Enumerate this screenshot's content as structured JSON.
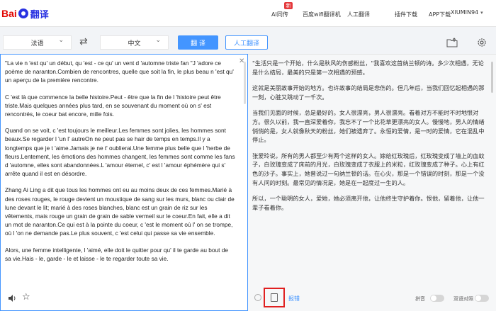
{
  "header": {
    "logo_text": "Bai",
    "logo_text_2": "du",
    "logo_suffix": "翻译",
    "nav": [
      {
        "label": "AI同传",
        "badge": "新"
      },
      {
        "label": "百度wifi翻译机"
      },
      {
        "label": "人工翻译"
      },
      {
        "label": "插件下载"
      },
      {
        "label": "APP下载"
      }
    ],
    "user": "XIUMIN94"
  },
  "toolbar": {
    "source_lang": "法语",
    "target_lang": "中文",
    "translate_label": "翻 译",
    "human_label": "人工翻译",
    "icons": [
      "swap-icon",
      "folder-upload-icon",
      "settings-icon"
    ]
  },
  "source": {
    "paragraphs": [
      "\"La vie n 'est qu' un début, qu 'est - ce qu' un vent d 'automne triste fan \"J 'adore ce poème de naranton.Combien de rencontres, quelle que soit la fin, le plus beau n 'est qu' un aperçu de la première rencontre.",
      "C 'est là que commence la belle histoire.Peut - être que la fin de l 'histoire peut être triste.Mais quelques années plus tard, en se souvenant du moment où on s' est rencontrés, le coeur bat encore, mille fois.",
      "Quand on se voit, c 'est toujours le meilleur.Les femmes sont jolies, les hommes sont beaux.Se regarder l 'un l' autreOn ne peut pas se hair de temps en temps.Il y a longtemps que je t 'aime.Jamais je ne t' oublierai.Une femme plus belle que l 'herbe de fleurs.Lentement, les émotions des hommes changent, les femmes sont comme les fans d 'automne, elles sont abandonnées.L 'amour éternel, c' est l 'amour éphémère qui s' arrête quand il est en désordre.",
      "Zhang Ai Ling a dit que tous les hommes ont eu au moins deux de ces femmes.Marié à des roses rouges, le rouge devient un moustique de sang sur les murs, blanc ou clair de lune devant le lit; marié à des roses blanches, blanc est un grain de riz sur les vêtements, mais rouge un grain de grain de sable vermeil sur le coeur.En fait, elle a dit un mot de naranton.Ce qui est à la pointe du coeur, c 'est le moment où l' on se trompe, où l 'on ne demande pas.Le plus souvent, c 'est celui qui passe sa vie ensemble.",
      "Alors, une femme intelligente, l 'aimé, elle doit le quitter pour qu' il te garde au bout de sa vie.Hais - le, garde - le et laisse - le te regarder toute sa vie."
    ]
  },
  "target": {
    "paragraphs": [
      "\"生活只是一个开始，什么是秋风的伤感粉丝，\"我喜欢这首纳兰顿的诗。多少次相遇，无论是什么结局，最美的只是第一次相遇的预感。",
      "这就是美丽故事开始的地方。也许故事的结局是悲伤的。但几年后，当我们回忆起相遇的那一刻，心脏又跳动了一千次。",
      "当我们见面的时候，总是最好的。女人很漂亮，男人很漂亮。看着对方不能时不时地恨对方。很久以前，我一直深爱着你，我忘不了一个比花草更漂亮的女人。慢慢地，男人的情绪悄悄的是，女人就像秋天的粉丝，她们被遗弃了。永恒的爱情，是一时的爱情，它在混乱中停止。",
      "张爱玲说，所有的男人都至少有两个这样的女人。嫁给红玫瑰后，红玫瑰变成了墙上的血蚊子，白玫瑰变成了床前的月光，白玫瑰变成了衣服上的米粒，红玫瑰变成了种子。心上有红色的沙子。事实上，她曾说过一句纳兰顿的话。在心尖，那是一个错误的时刻，那是一个没有人问的时刻。最常见的情况是，她是在一起度过一生的人。",
      "所以，一个聪明的女人，爱她，她必须离开他，让他终生守护着你。恨他，留着他，让他一辈子看着你。"
    ]
  },
  "footer": {
    "report_label": "报错",
    "toggle1_label": "拼音",
    "toggle2_label": "双语对照"
  },
  "colors": {
    "accent": "#4395ff",
    "highlight_box": "#e02020",
    "logo_red": "#e10602",
    "logo_blue": "#2932e1"
  }
}
